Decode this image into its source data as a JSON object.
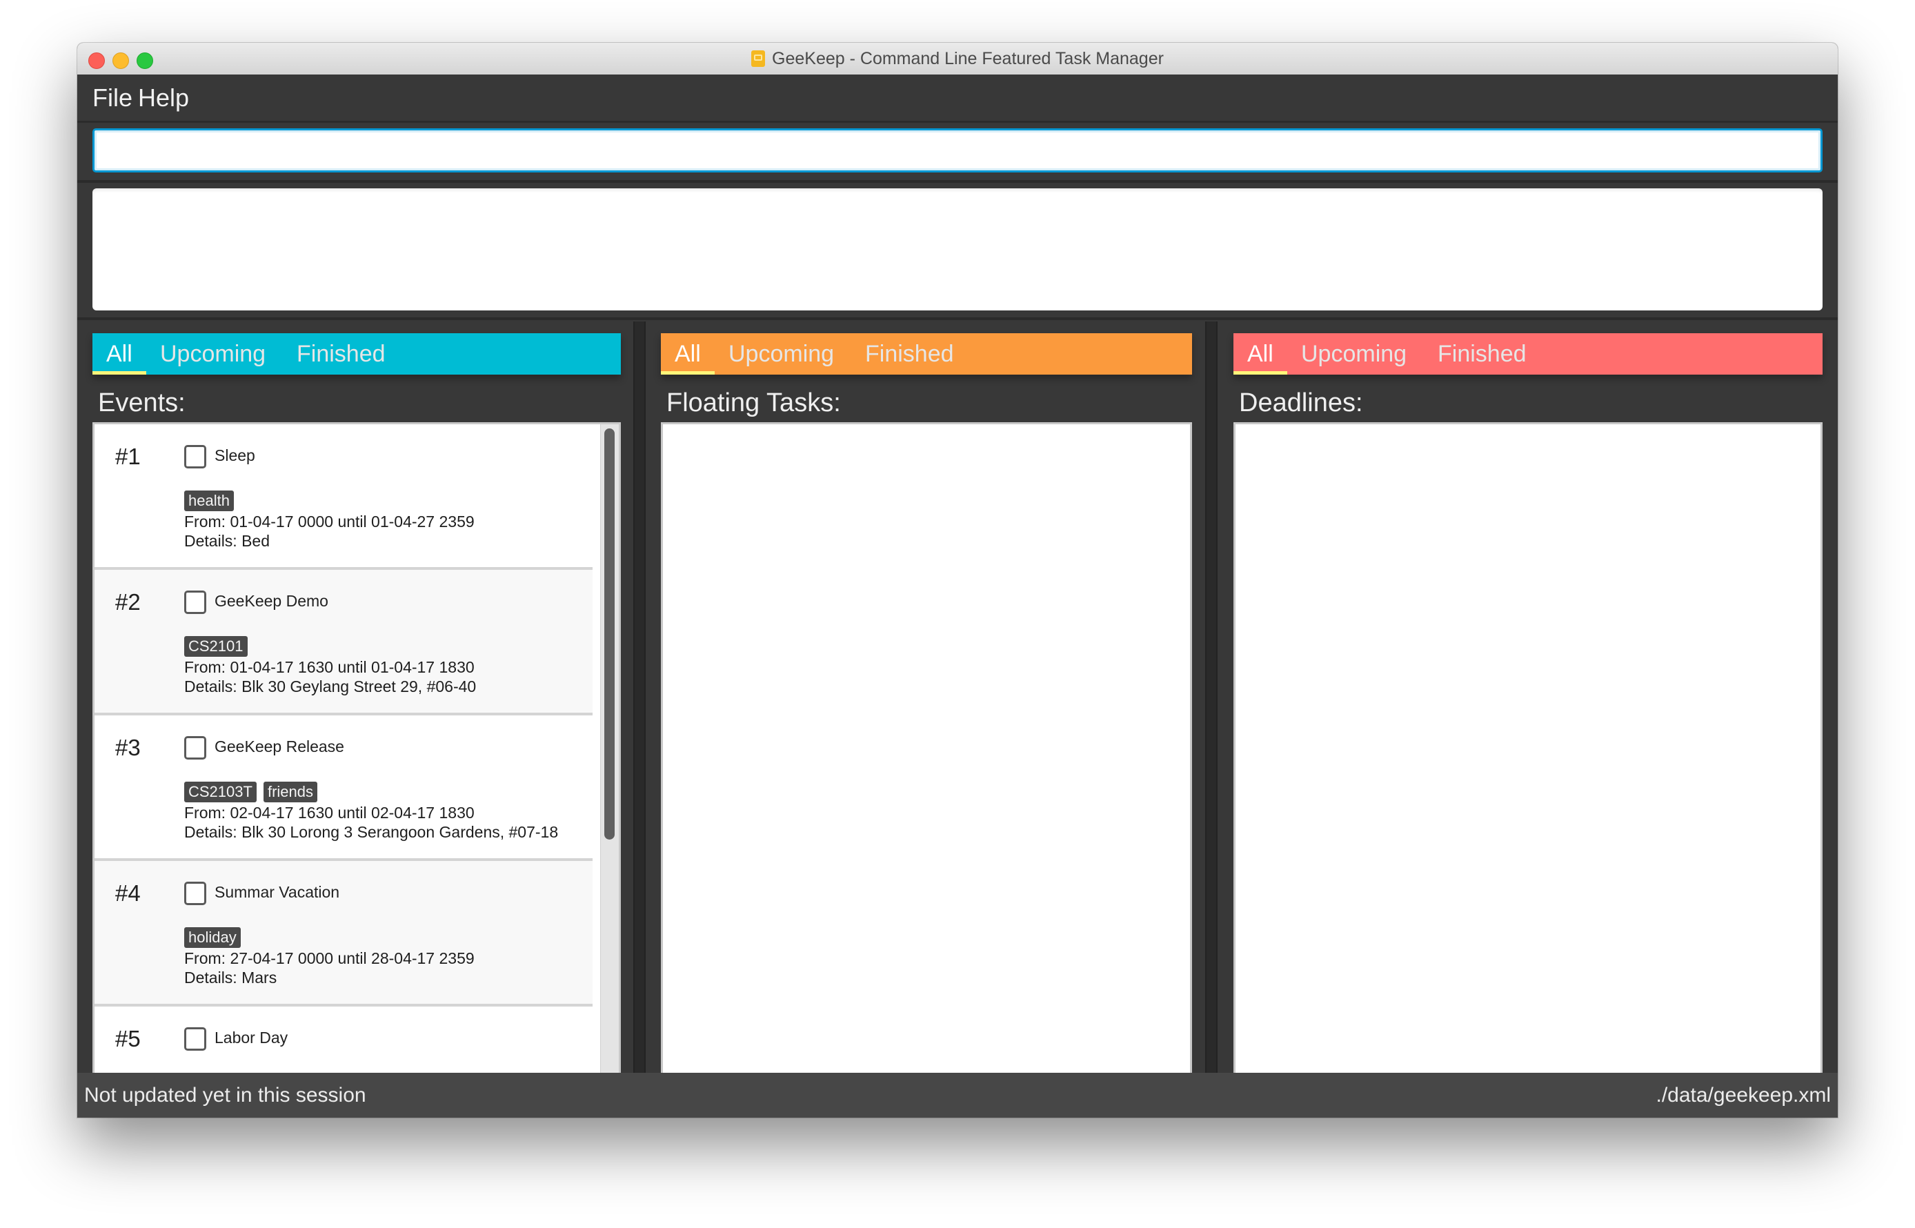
{
  "window": {
    "title": "GeeKeep - Command Line Featured Task Manager",
    "app_icon": "geekeep-app-icon"
  },
  "menu": {
    "items": [
      {
        "label": "File"
      },
      {
        "label": "Help"
      }
    ]
  },
  "command": {
    "value": "",
    "placeholder": ""
  },
  "result": {
    "text": ""
  },
  "panes": [
    {
      "id": "events",
      "title": "Events:",
      "accent": "#00bcd4",
      "tabs": [
        {
          "label": "All",
          "active": true
        },
        {
          "label": "Upcoming",
          "active": false
        },
        {
          "label": "Finished",
          "active": false
        }
      ]
    },
    {
      "id": "floating",
      "title": "Floating Tasks:",
      "accent": "#fb9a3d",
      "tabs": [
        {
          "label": "All",
          "active": true
        },
        {
          "label": "Upcoming",
          "active": false
        },
        {
          "label": "Finished",
          "active": false
        }
      ]
    },
    {
      "id": "deadlines",
      "title": "Deadlines:",
      "accent": "#ff6e6e",
      "tabs": [
        {
          "label": "All",
          "active": true
        },
        {
          "label": "Upcoming",
          "active": false
        },
        {
          "label": "Finished",
          "active": false
        }
      ]
    }
  ],
  "events": [
    {
      "index": "#1",
      "name": "Sleep",
      "done": false,
      "tags": [
        "health"
      ],
      "from": "From: 01-04-17 0000 until 01-04-27 2359",
      "details": "Details: Bed"
    },
    {
      "index": "#2",
      "name": "GeeKeep Demo",
      "done": false,
      "tags": [
        "CS2101"
      ],
      "from": "From: 01-04-17 1630 until 01-04-17 1830",
      "details": "Details: Blk 30 Geylang Street 29, #06-40"
    },
    {
      "index": "#3",
      "name": "GeeKeep Release",
      "done": false,
      "tags": [
        "CS2103T",
        "friends"
      ],
      "from": "From: 02-04-17 1630 until 02-04-17 1830",
      "details": "Details: Blk 30 Lorong 3 Serangoon Gardens, #07-18"
    },
    {
      "index": "#4",
      "name": "Summar Vacation",
      "done": false,
      "tags": [
        "holiday"
      ],
      "from": "From: 27-04-17 0000 until 28-04-17 2359",
      "details": "Details: Mars"
    },
    {
      "index": "#5",
      "name": "Labor Day",
      "done": false,
      "tags": [],
      "from": "",
      "details": ""
    }
  ],
  "floating_tasks": [],
  "deadlines": [],
  "status": {
    "sync": "Not updated yet in this session",
    "path": "./data/geekeep.xml"
  }
}
